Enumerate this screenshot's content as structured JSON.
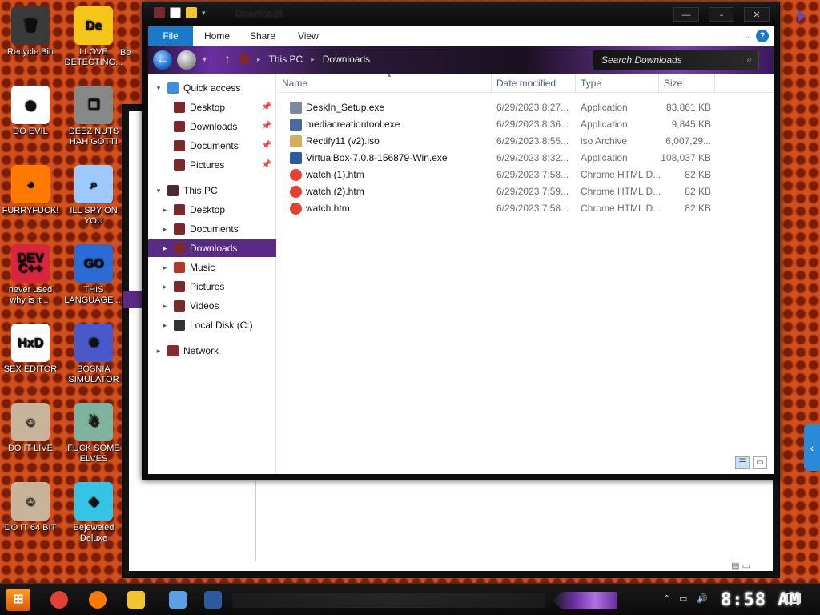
{
  "desktop": {
    "icons": [
      {
        "label": "Recycle Bin",
        "color": "#3a3a3a",
        "glyph": "🗑"
      },
      {
        "label": "I LOVE DETECTING...",
        "color": "#f5c518",
        "glyph": "De"
      },
      {
        "label": "DO EVIL",
        "color": "#ffffff",
        "glyph": "◉"
      },
      {
        "label": "DEEZ NUTS HAH GOTTI",
        "color": "#888888",
        "glyph": "❐"
      },
      {
        "label": "FURRYFUCK!",
        "color": "#ff7a00",
        "glyph": "◕"
      },
      {
        "label": "ILL SPY ON YOU",
        "color": "#9ec9ff",
        "glyph": "⌕"
      },
      {
        "label": "never used why is it ...",
        "color": "#d7263d",
        "glyph": "DEV C++"
      },
      {
        "label": "THIS LANGUAGE ...",
        "color": "#2b6bd6",
        "glyph": "GO"
      },
      {
        "label": "SEX EDITOR",
        "color": "#ffffff",
        "glyph": "HxD"
      },
      {
        "label": "BOSNIA SIMULATOR",
        "color": "#4a58c8",
        "glyph": "✹"
      },
      {
        "label": "DO IT LIVE",
        "color": "#c8b49a",
        "glyph": "☺"
      },
      {
        "label": "FUCK SOME ELVES",
        "color": "#7fb3a0",
        "glyph": "☃"
      },
      {
        "label": "DO IT 64 BIT",
        "color": "#c8b49a",
        "glyph": "☺"
      },
      {
        "label": "Bejeweled Deluxe",
        "color": "#35c4e6",
        "glyph": "◆"
      }
    ],
    "partial_label": "Be"
  },
  "window": {
    "title": "Downloads",
    "controls": {
      "minimize": "—",
      "maximize": "▫",
      "close": "✕"
    }
  },
  "ribbon": {
    "tabs": [
      "File",
      "Home",
      "Share",
      "View"
    ],
    "help": "?"
  },
  "address": {
    "crumbs": [
      "This PC",
      "Downloads"
    ],
    "search_placeholder": "Search Downloads"
  },
  "nav": {
    "items": [
      {
        "label": "Quick access",
        "level": 0,
        "arrow": "▾",
        "icon_color": "#3a8ee6",
        "pinned": false,
        "selected": false
      },
      {
        "label": "Desktop",
        "level": 1,
        "arrow": "",
        "icon_color": "#7a2a2a",
        "pinned": true,
        "selected": false
      },
      {
        "label": "Downloads",
        "level": 1,
        "arrow": "",
        "icon_color": "#7a2a2a",
        "pinned": true,
        "selected": false
      },
      {
        "label": "Documents",
        "level": 1,
        "arrow": "",
        "icon_color": "#7a2a2a",
        "pinned": true,
        "selected": false
      },
      {
        "label": "Pictures",
        "level": 1,
        "arrow": "",
        "icon_color": "#7a2a2a",
        "pinned": true,
        "selected": false
      },
      {
        "label": "This PC",
        "level": 0,
        "arrow": "▾",
        "icon_color": "#4a2a2a",
        "pinned": false,
        "selected": false
      },
      {
        "label": "Desktop",
        "level": 1,
        "arrow": "▸",
        "icon_color": "#7a2a2a",
        "pinned": false,
        "selected": false
      },
      {
        "label": "Documents",
        "level": 1,
        "arrow": "▸",
        "icon_color": "#7a2a2a",
        "pinned": false,
        "selected": false
      },
      {
        "label": "Downloads",
        "level": 1,
        "arrow": "▸",
        "icon_color": "#7a2a2a",
        "pinned": false,
        "selected": true
      },
      {
        "label": "Music",
        "level": 1,
        "arrow": "▸",
        "icon_color": "#b03a2a",
        "pinned": false,
        "selected": false
      },
      {
        "label": "Pictures",
        "level": 1,
        "arrow": "▸",
        "icon_color": "#7a2a2a",
        "pinned": false,
        "selected": false
      },
      {
        "label": "Videos",
        "level": 1,
        "arrow": "▸",
        "icon_color": "#7a2a2a",
        "pinned": false,
        "selected": false
      },
      {
        "label": "Local Disk (C:)",
        "level": 1,
        "arrow": "▸",
        "icon_color": "#333333",
        "pinned": false,
        "selected": false
      },
      {
        "label": "Network",
        "level": 0,
        "arrow": "▸",
        "icon_color": "#8a2a2a",
        "pinned": false,
        "selected": false
      }
    ]
  },
  "files": {
    "columns": [
      "Name",
      "Date modified",
      "Type",
      "Size"
    ],
    "rows": [
      {
        "name": "DeskIn_Setup.exe",
        "date": "6/29/2023 8:27...",
        "type": "Application",
        "size": "83,861 KB",
        "icon_color": "#7a8aa0"
      },
      {
        "name": "mediacreationtool.exe",
        "date": "6/29/2023 8:36...",
        "type": "Application",
        "size": "9,845 KB",
        "icon_color": "#4a6aa0"
      },
      {
        "name": "Rectify11 (v2).iso",
        "date": "6/29/2023 8:55...",
        "type": "iso Archive",
        "size": "6,007,29...",
        "icon_color": "#d0b060"
      },
      {
        "name": "VirtualBox-7.0.8-156879-Win.exe",
        "date": "6/29/2023 8:32...",
        "type": "Application",
        "size": "108,037 KB",
        "icon_color": "#2a5aa0"
      },
      {
        "name": "watch (1).htm",
        "date": "6/29/2023 7:58...",
        "type": "Chrome HTML D...",
        "size": "82 KB",
        "icon_color": "#e34133"
      },
      {
        "name": "watch (2).htm",
        "date": "6/29/2023 7:59...",
        "type": "Chrome HTML D...",
        "size": "82 KB",
        "icon_color": "#e34133"
      },
      {
        "name": "watch.htm",
        "date": "6/29/2023 7:58...",
        "type": "Chrome HTML D...",
        "size": "82 KB",
        "icon_color": "#e34133"
      }
    ]
  },
  "taskbar": {
    "clock": "8:58 AM",
    "apps": [
      {
        "name": "chrome",
        "color": "#e34133"
      },
      {
        "name": "firefox",
        "color": "#ff7a00"
      },
      {
        "name": "file-explorer",
        "color": "#f4c430"
      },
      {
        "name": "app-window",
        "color": "#5aa0e6"
      },
      {
        "name": "virtualbox",
        "color": "#2a5aa0"
      }
    ]
  },
  "colors": {
    "accent": "#1979ca",
    "selection": "#5b2a86"
  }
}
